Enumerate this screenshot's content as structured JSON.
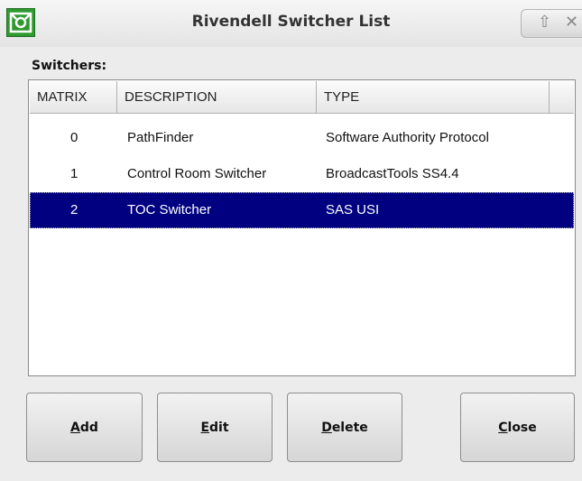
{
  "window": {
    "title": "Rivendell Switcher List",
    "controls": [
      "up-arrow-icon",
      "close-icon"
    ]
  },
  "list_label": "Switchers:",
  "columns": [
    "MATRIX",
    "DESCRIPTION",
    "TYPE"
  ],
  "rows": [
    {
      "matrix": "0",
      "description": "PathFinder",
      "type": "Software Authority Protocol",
      "selected": false
    },
    {
      "matrix": "1",
      "description": "Control Room Switcher",
      "type": "BroadcastTools SS4.4",
      "selected": false
    },
    {
      "matrix": "2",
      "description": "TOC Switcher",
      "type": "SAS USI",
      "selected": true
    }
  ],
  "buttons": {
    "add": {
      "mnemonic": "A",
      "rest": "dd"
    },
    "edit": {
      "mnemonic": "E",
      "rest": "dit"
    },
    "delete": {
      "mnemonic": "D",
      "rest": "elete"
    },
    "close": {
      "mnemonic": "C",
      "rest": "lose"
    }
  },
  "colors": {
    "selection": "#000080",
    "app_icon": "#2f9a2f"
  }
}
